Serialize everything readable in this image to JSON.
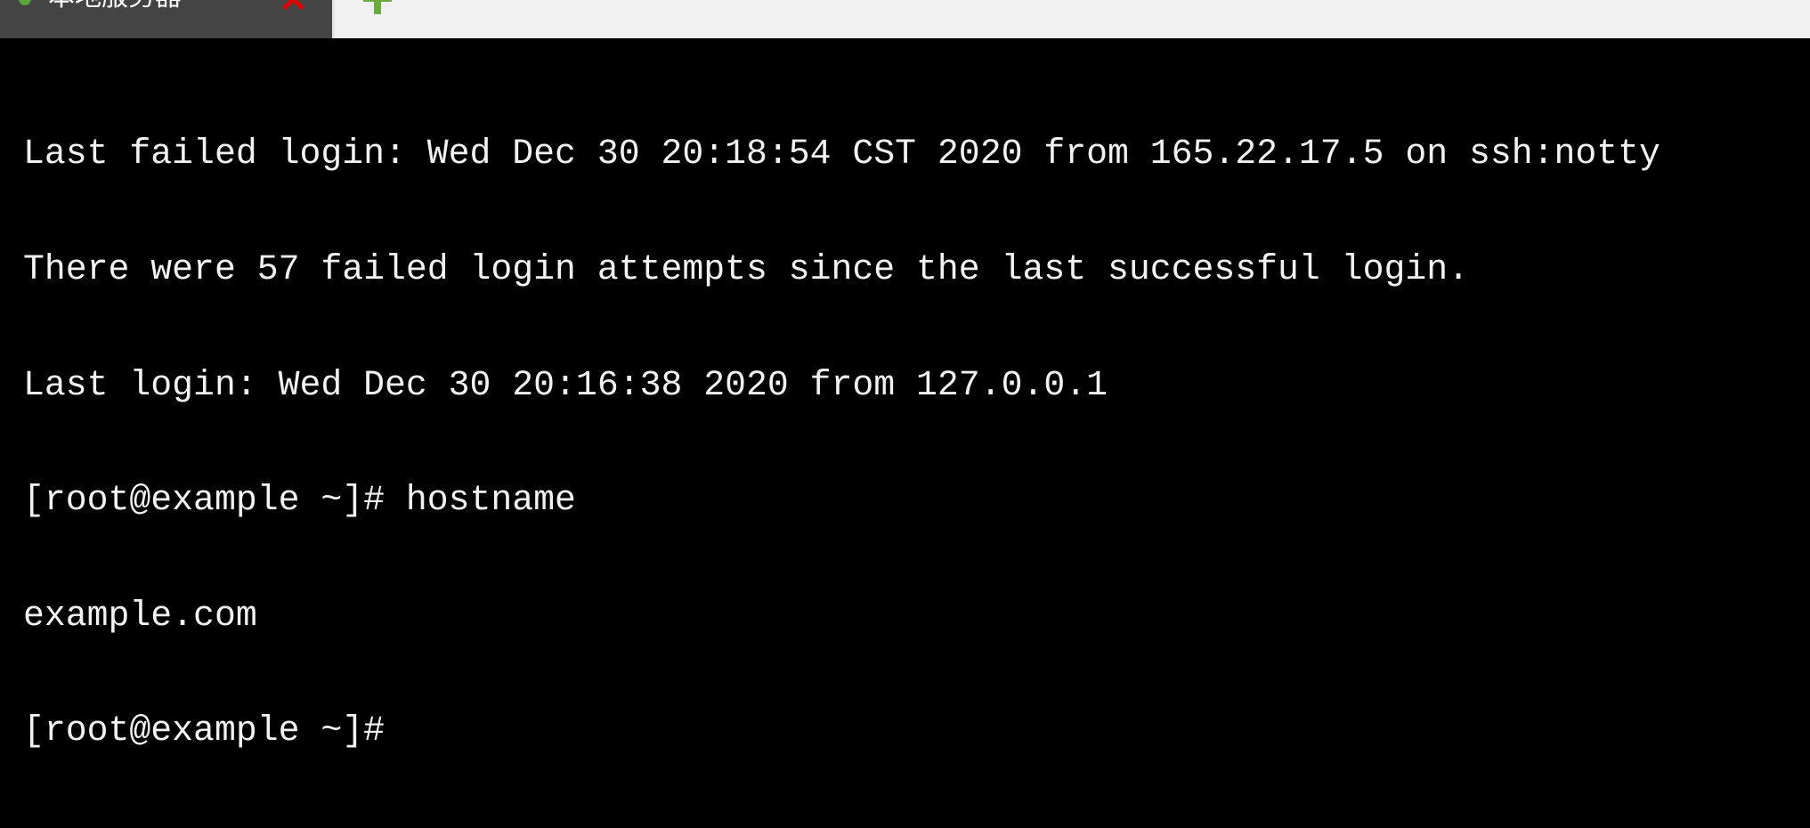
{
  "tabs": [
    {
      "label": "本地服务器",
      "status_icon": "connected-dot-icon",
      "status_color": "#5aa63a",
      "close_icon": "close-icon",
      "close_color": "#dd0000",
      "active": true
    }
  ],
  "new_tab": {
    "icon": "plus-icon",
    "color": "#6aaa3f"
  },
  "terminal": {
    "lines": [
      "Last failed login: Wed Dec 30 20:18:54 CST 2020 from 165.22.17.5 on ssh:notty",
      "There were 57 failed login attempts since the last successful login.",
      "Last login: Wed Dec 30 20:16:38 2020 from 127.0.0.1",
      "[root@example ~]# hostname",
      "example.com",
      "[root@example ~]#"
    ]
  }
}
